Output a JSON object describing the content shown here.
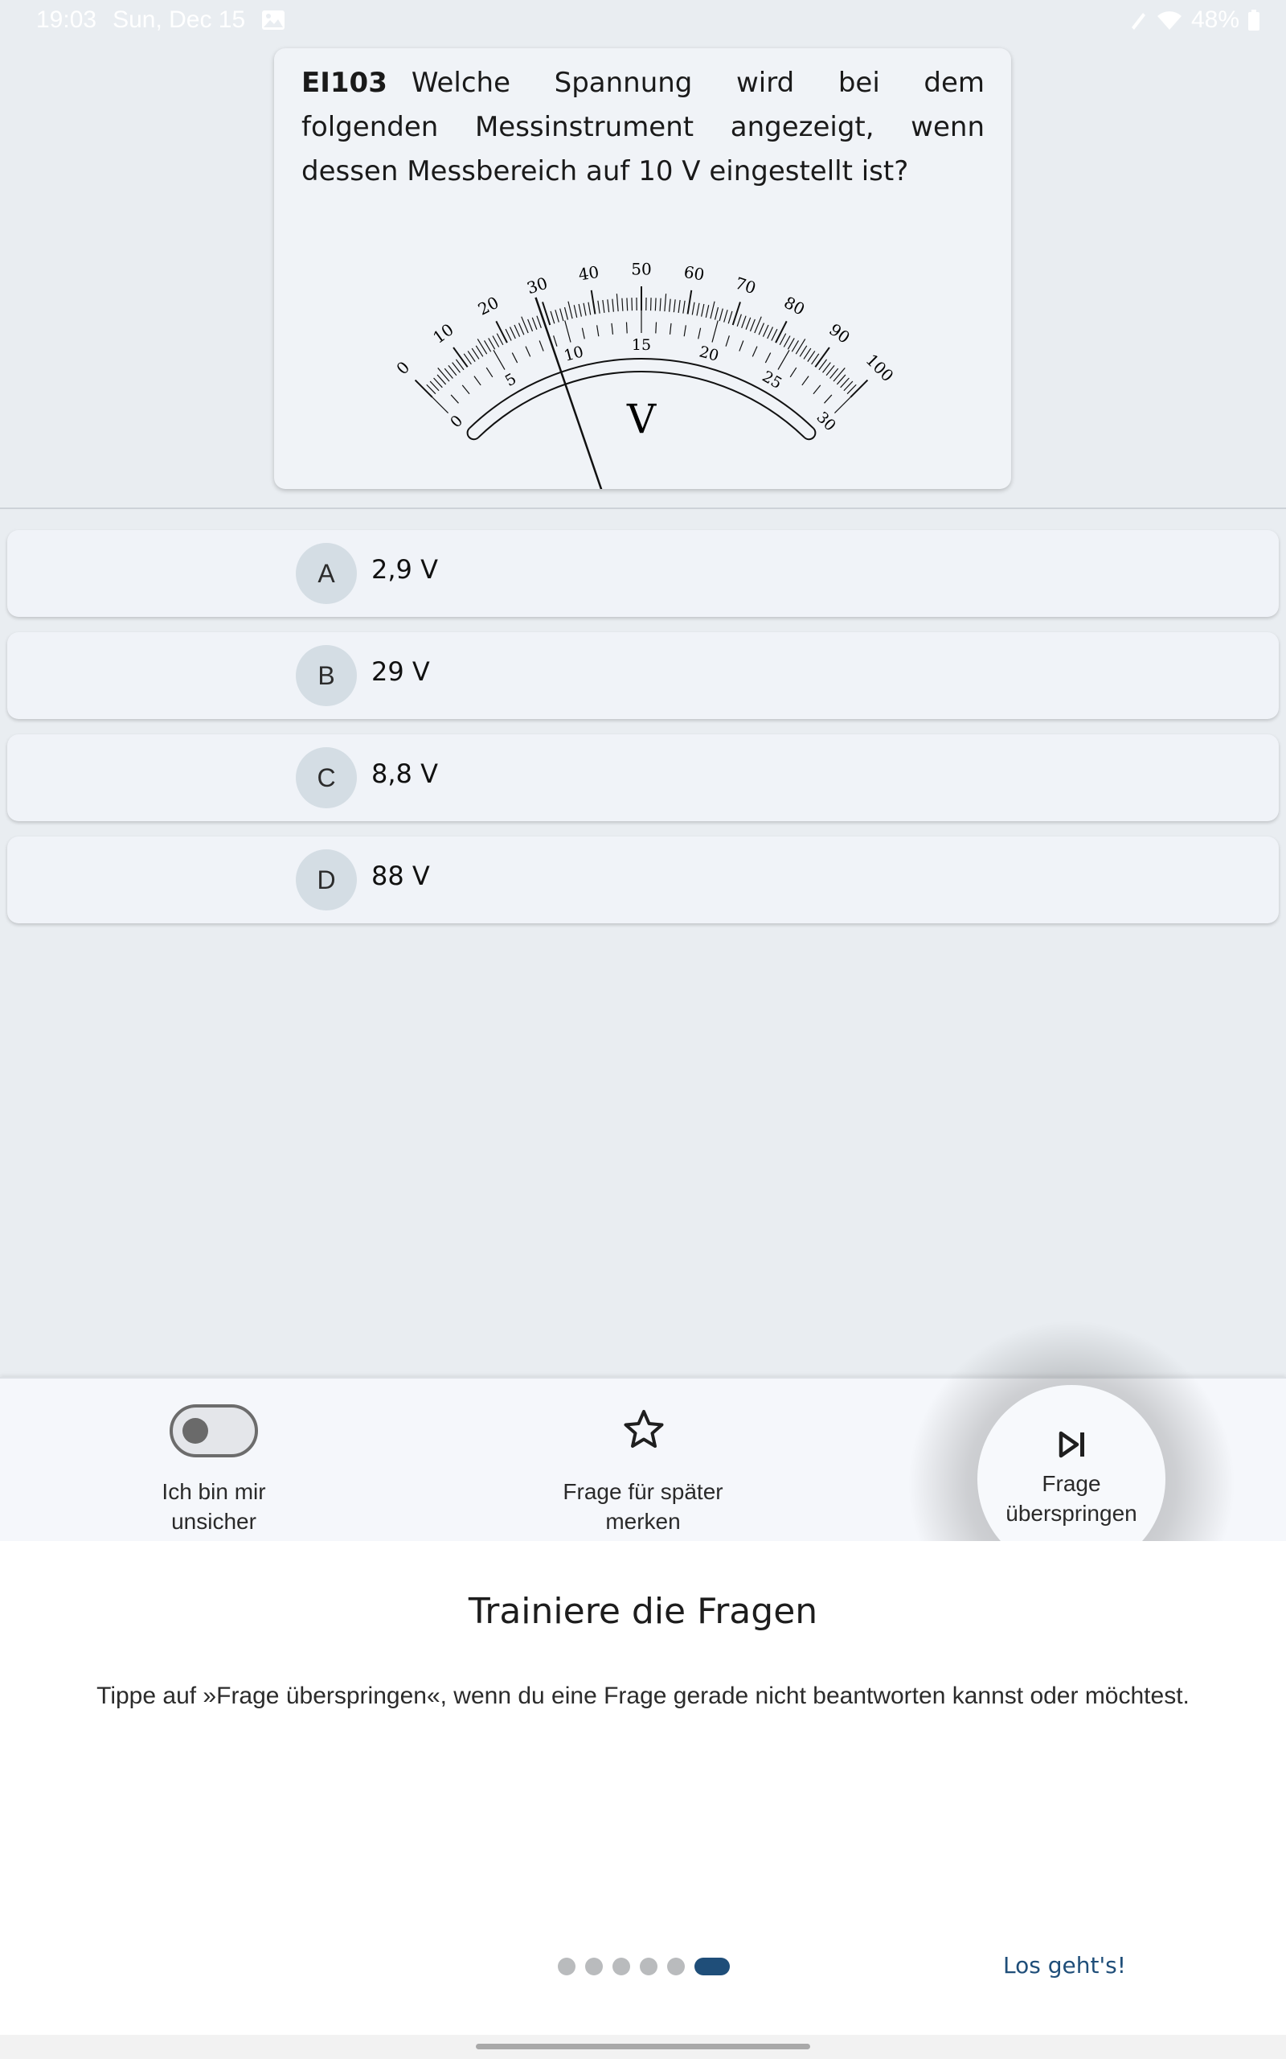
{
  "status_bar": {
    "time": "19:03",
    "date": "Sun, Dec 15",
    "battery": "48%",
    "icons": [
      "gallery-icon",
      "pen-icon",
      "wifi-icon",
      "battery-icon"
    ]
  },
  "question": {
    "id": "EI103",
    "text": "Welche Spannung wird bei dem folgenden Messinstrument angezeigt, wenn dessen Messbereich auf 10 V eingestellt ist?"
  },
  "meter": {
    "unit": "V",
    "outer_scale": {
      "min": 0,
      "max": 100,
      "label_step": 10
    },
    "inner_scale": {
      "min": 0,
      "max": 30,
      "label_step": 5
    },
    "needle_on_outer_scale": 29
  },
  "answers": [
    {
      "letter": "A",
      "text": "2,9 V"
    },
    {
      "letter": "B",
      "text": "29 V"
    },
    {
      "letter": "C",
      "text": "8,8 V"
    },
    {
      "letter": "D",
      "text": "88 V"
    }
  ],
  "actions": {
    "unsure_label": "Ich bin mir\nunsicher",
    "unsure_toggle_on": false,
    "bookmark_label": "Frage für später\nmerken",
    "skip_label": "Frage\nüberspringen"
  },
  "onboarding": {
    "title": "Trainiere die Fragen",
    "body": "Tippe auf »Frage überspringen«, wenn du eine Frage gerade nicht beantworten kannst oder möchtest.",
    "page_count": 6,
    "current_page": 6,
    "start_label": "Los geht's!"
  },
  "colors": {
    "accent": "#1f4e79",
    "background": "#e9edf1",
    "card": "#f0f3f7"
  }
}
